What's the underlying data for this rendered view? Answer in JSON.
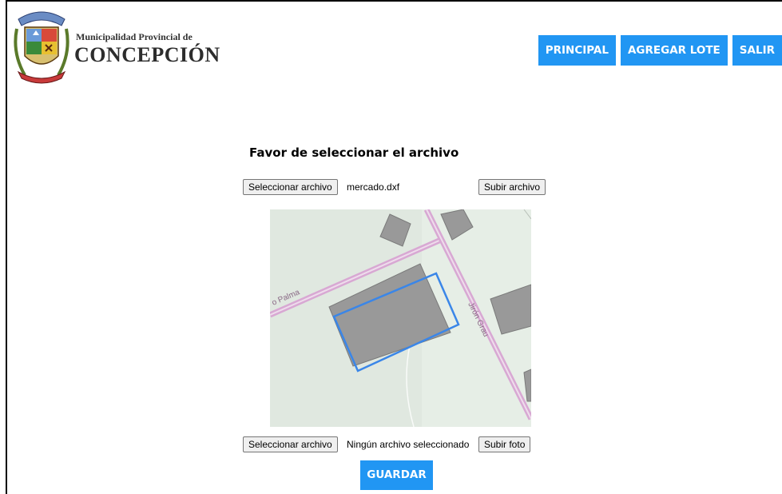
{
  "brand": {
    "subtitle": "Municipalidad Provincial de",
    "title": "CONCEPCIÓN"
  },
  "nav": {
    "items": [
      "PRINCIPAL",
      "AGREGAR LOTE",
      "SALIR"
    ]
  },
  "form": {
    "title": "Favor de seleccionar el archivo",
    "file_button_label": "Seleccionar archivo",
    "dxf_file_name": "mercado.dxf",
    "upload_file_label": "Subir archivo",
    "photo_button_label": "Seleccionar archivo",
    "photo_file_name": "Ningún archivo seleccionado",
    "upload_photo_label": "Subir foto",
    "save_label": "GUARDAR"
  },
  "map": {
    "street_labels": [
      "o Palma",
      "Jirón Grau"
    ]
  },
  "colors": {
    "accent": "#2196f3",
    "map_background": "#e0e8e0",
    "road": "#d8a8d3",
    "building": "#999999",
    "lot_outline": "#3a86e8"
  }
}
